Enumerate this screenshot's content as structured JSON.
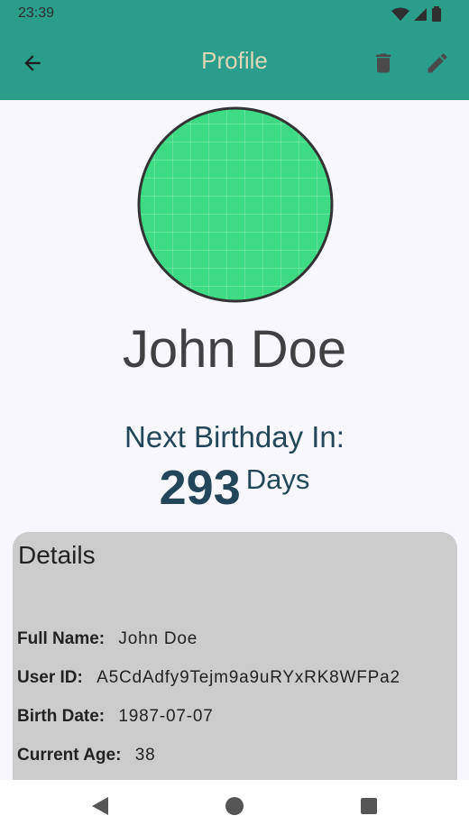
{
  "status_bar": {
    "time": "23:39",
    "icons": [
      "wifi-icon",
      "signal-icon",
      "battery-icon"
    ]
  },
  "app_bar": {
    "title": "Profile",
    "back_icon": "arrow-back-icon",
    "actions": [
      "delete-icon",
      "edit-icon"
    ]
  },
  "profile": {
    "name": "John Doe",
    "avatar_color": "#3ddc84"
  },
  "birthday": {
    "label": "Next Birthday In:",
    "days": "293",
    "unit": "Days"
  },
  "details": {
    "title": "Details",
    "rows": [
      {
        "label": "Full Name:",
        "value": "John Doe"
      },
      {
        "label": "User ID:",
        "value": "A5CdAdfy9Tejm9a9uRYxRK8WFPa2"
      },
      {
        "label": "Birth Date:",
        "value": "1987-07-07"
      },
      {
        "label": "Current Age:",
        "value": "38"
      }
    ]
  },
  "nav_bar": {
    "buttons": [
      "back-triangle-icon",
      "home-circle-icon",
      "recents-square-icon"
    ]
  },
  "colors": {
    "app_bar": "#2a9d8b",
    "text_dark": "#24465a",
    "card": "#cccccc"
  }
}
